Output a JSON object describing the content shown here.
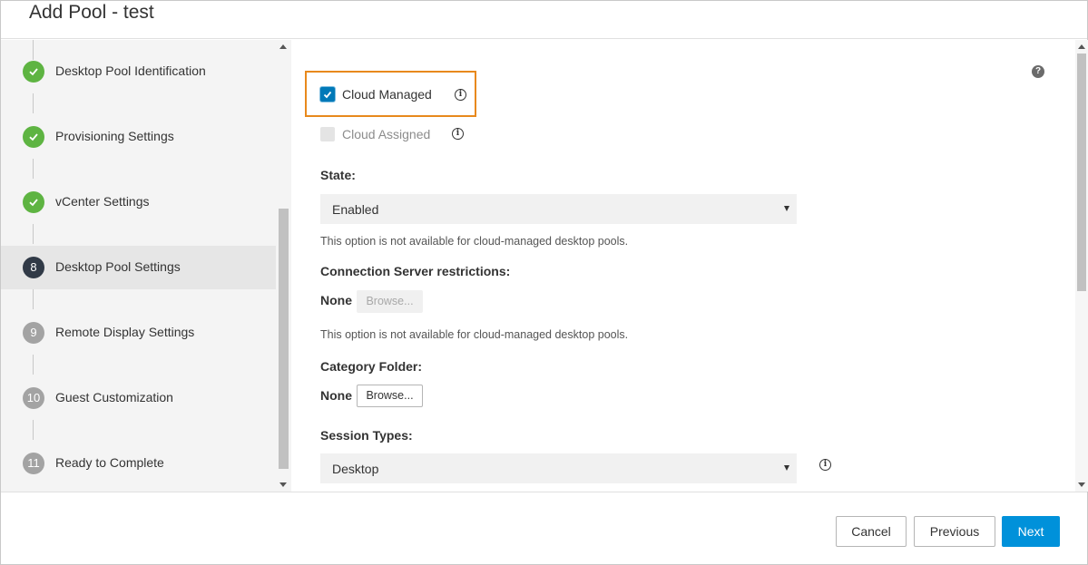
{
  "dialog": {
    "title": "Add Pool - test"
  },
  "steps": [
    {
      "number": "",
      "label": "Desktop Pool Identification",
      "status": "done"
    },
    {
      "number": "",
      "label": "Provisioning Settings",
      "status": "done"
    },
    {
      "number": "",
      "label": "vCenter Settings",
      "status": "done"
    },
    {
      "number": "8",
      "label": "Desktop Pool Settings",
      "status": "current"
    },
    {
      "number": "9",
      "label": "Remote Display Settings",
      "status": "pending"
    },
    {
      "number": "10",
      "label": "Guest Customization",
      "status": "pending"
    },
    {
      "number": "11",
      "label": "Ready to Complete",
      "status": "pending"
    }
  ],
  "form": {
    "help": "?",
    "cloud_managed": {
      "label": "Cloud Managed",
      "checked": true
    },
    "cloud_assigned": {
      "label": "Cloud Assigned",
      "checked": false,
      "disabled": true
    },
    "state": {
      "label": "State:",
      "value": "Enabled",
      "hint": "This option is not available for cloud-managed desktop pools."
    },
    "connection_server": {
      "label": "Connection Server restrictions:",
      "value": "None",
      "browse": "Browse...",
      "hint": "This option is not available for cloud-managed desktop pools."
    },
    "category_folder": {
      "label": "Category Folder:",
      "value": "None",
      "browse": "Browse..."
    },
    "session_types": {
      "label": "Session Types:",
      "value": "Desktop"
    }
  },
  "footer": {
    "cancel": "Cancel",
    "previous": "Previous",
    "next": "Next"
  },
  "colors": {
    "accent": "#0091da",
    "highlight": "#e8891c",
    "done": "#5eb442",
    "current": "#313a47",
    "pending": "#a3a3a3"
  }
}
